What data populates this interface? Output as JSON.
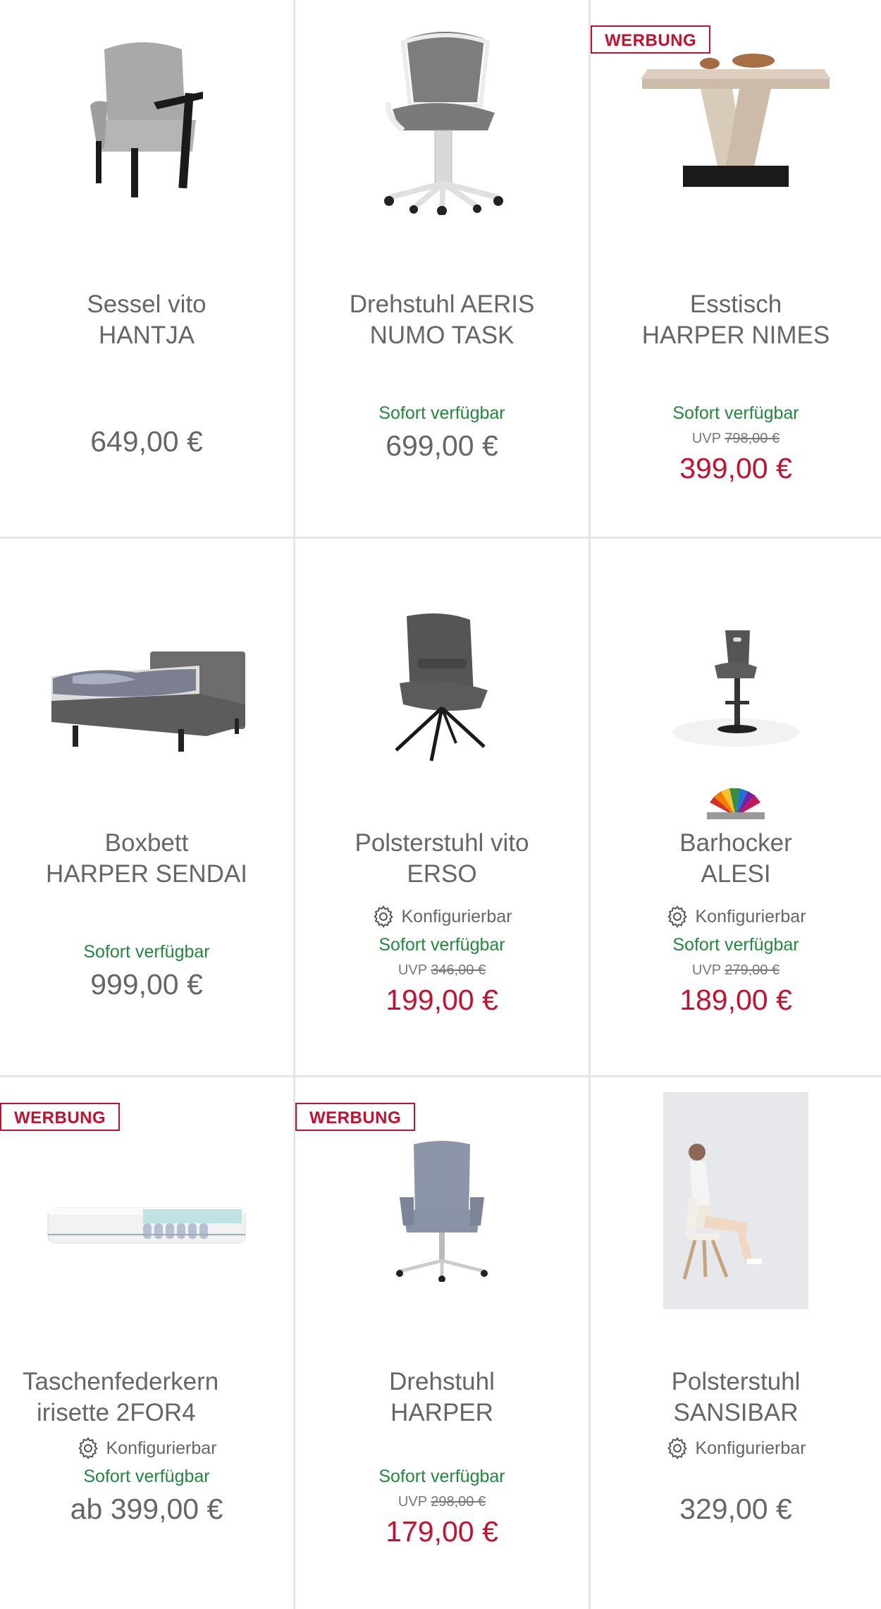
{
  "products": [
    {
      "badge": "",
      "title1": "Sessel vito",
      "title2": "HANTJA",
      "config": "",
      "availability": "",
      "uvp_label": "",
      "uvp": "",
      "price": "649,00 €",
      "sale": false,
      "image": "armchair"
    },
    {
      "badge": "",
      "title1": "Drehstuhl AERIS",
      "title2": "NUMO TASK",
      "config": "",
      "availability": "Sofort verfügbar",
      "uvp_label": "",
      "uvp": "",
      "price": "699,00 €",
      "sale": false,
      "image": "office-chair"
    },
    {
      "badge": "WERBUNG",
      "title1": "Esstisch",
      "title2": "HARPER NIMES",
      "config": "",
      "availability": "Sofort verfügbar",
      "uvp_label": "UVP",
      "uvp": "798,00 €",
      "price": "399,00 €",
      "sale": true,
      "image": "dining-table"
    },
    {
      "badge": "",
      "title1": "Boxbett",
      "title2": "HARPER SENDAI",
      "config": "",
      "availability": "Sofort verfügbar",
      "uvp_label": "",
      "uvp": "",
      "price": "999,00 €",
      "sale": false,
      "image": "boxspring-bed"
    },
    {
      "badge": "",
      "title1": "Polsterstuhl vito",
      "title2": "ERSO",
      "config": "Konfigurierbar",
      "availability": "Sofort verfügbar",
      "uvp_label": "UVP",
      "uvp": "346,00 €",
      "price": "199,00 €",
      "sale": true,
      "image": "upholstered-chair"
    },
    {
      "badge": "",
      "title1": "Barhocker",
      "title2": "ALESI",
      "config": "Konfigurierbar",
      "availability": "Sofort verfügbar",
      "uvp_label": "UVP",
      "uvp": "279,00 €",
      "price": "189,00 €",
      "sale": true,
      "image": "bar-stool"
    },
    {
      "badge": "WERBUNG",
      "title1": "Taschenfederkern",
      "title2": "irisette 2FOR4",
      "config": "Konfigurierbar",
      "availability": "Sofort verfügbar",
      "uvp_label": "",
      "uvp": "",
      "price": "ab 399,00 €",
      "sale": false,
      "image": "mattress"
    },
    {
      "badge": "WERBUNG",
      "title1": "Drehstuhl",
      "title2": "HARPER",
      "config": "",
      "availability": "Sofort verfügbar",
      "uvp_label": "UVP",
      "uvp": "298,00 €",
      "price": "179,00 €",
      "sale": true,
      "image": "executive-chair"
    },
    {
      "badge": "",
      "title1": "Polsterstuhl",
      "title2": "SANSIBAR",
      "config": "Konfigurierbar",
      "availability": "",
      "uvp_label": "",
      "uvp": "",
      "price": "329,00 €",
      "sale": false,
      "image": "woman-on-chair"
    }
  ]
}
